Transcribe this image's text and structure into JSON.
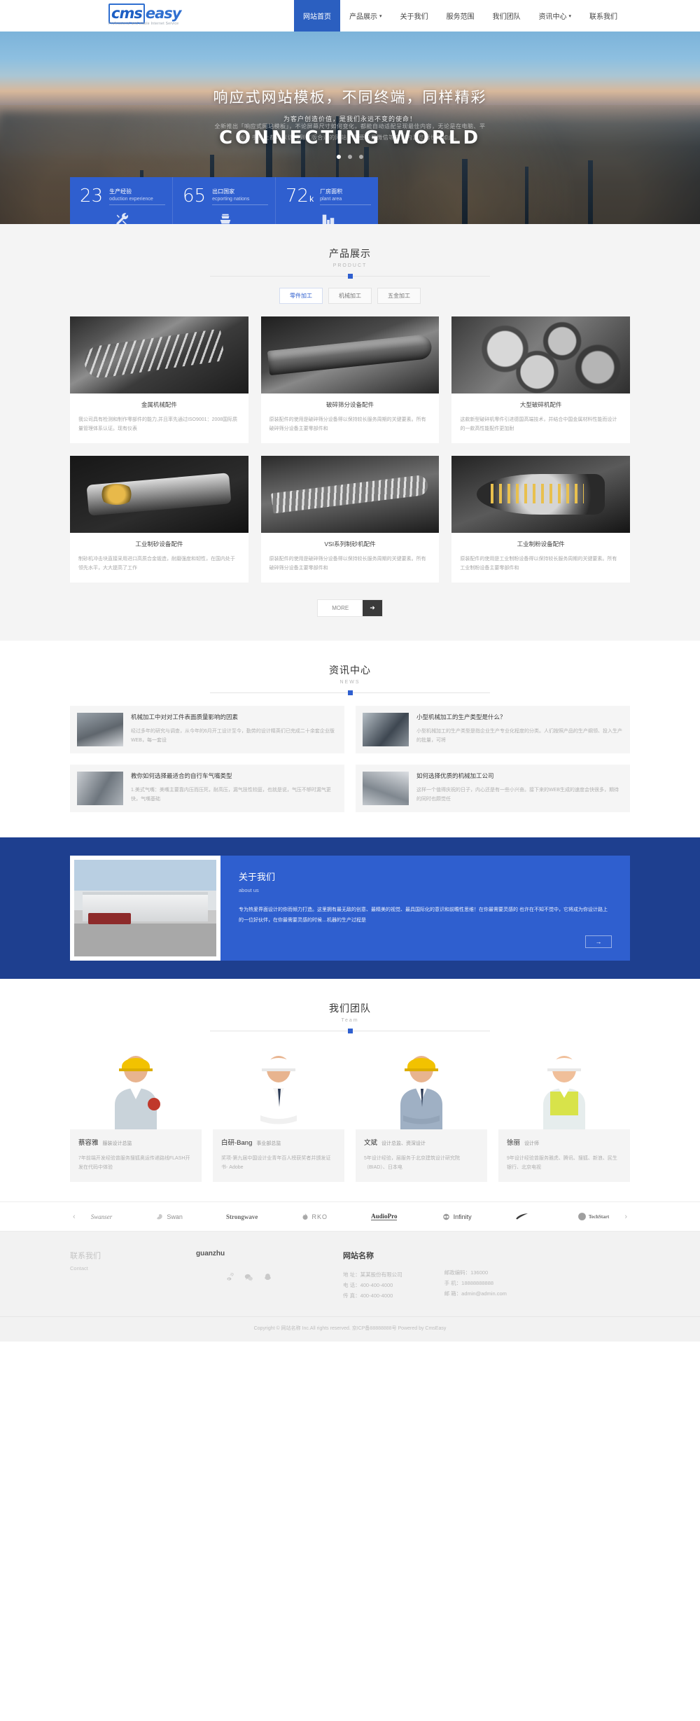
{
  "header": {
    "logo": {
      "cms": "cms",
      "easy": "easy",
      "tagline": "Professional and stable Internet Service"
    },
    "nav": [
      {
        "label": "网站首页",
        "caret": "",
        "active": true
      },
      {
        "label": "产品展示",
        "caret": "▾",
        "active": false
      },
      {
        "label": "关于我们",
        "caret": "",
        "active": false
      },
      {
        "label": "服务范围",
        "caret": "",
        "active": false
      },
      {
        "label": "我们团队",
        "caret": "",
        "active": false
      },
      {
        "label": "资讯中心",
        "caret": "▾",
        "active": false
      },
      {
        "label": "联系我们",
        "caret": "",
        "active": false
      }
    ]
  },
  "hero": {
    "headline": "响应式网站模板，不同终端，同样精彩",
    "subline": "为客户创造价值，是我们永远不变的使命！",
    "bigtext": "CONNECTING WORLD",
    "ghost_line1": "全新推出「响应式网站模板」，不论屏幕尺寸如何变化，都能自动适配呈现最佳内容，无论是在电脑、平",
    "ghost_line2": "板、手机上都可以访问到这版合适的网站，重要的是微信等应用内浏览器也是如此。"
  },
  "stats": [
    {
      "number": "23",
      "unit": "",
      "cn": "生产经验",
      "en": "oduction experience",
      "icon": "wrench-icon"
    },
    {
      "number": "65",
      "unit": "",
      "cn": "出口国家",
      "en": "ecporting nations",
      "icon": "ship-icon"
    },
    {
      "number": "72",
      "unit": "k",
      "cn": "厂房面积",
      "en": "plant area",
      "icon": "factory-icon"
    }
  ],
  "products": {
    "title_cn": "产品展示",
    "title_en": "PRODUCT",
    "tabs": [
      {
        "label": "零件加工",
        "active": true
      },
      {
        "label": "机械加工",
        "active": false
      },
      {
        "label": "五金加工",
        "active": false
      }
    ],
    "items": [
      {
        "title": "金属机械配件",
        "desc": "我公司具有检测和制作零部件的能力,并且率先通过ISO9001：2008国际质量管理体系认证。现有仪表",
        "thumb": "tool-a"
      },
      {
        "title": "破碎筛分设备配件",
        "desc": "原装配件的使用是破碎筛分设备得以保持较长服务周期的关键要素。所有破碎筛分设备主要零部件和",
        "thumb": "tool-b"
      },
      {
        "title": "大型破碎机配件",
        "desc": "这款新型破碎机零件引进德国高端技术，并结合中国金属材料性能而设计的一款高性能配件更加耐",
        "thumb": "gears"
      },
      {
        "title": "工业制砂设备配件",
        "desc": "制砂机冲击块直接采用进口高质合金锻造，耐磨强度和韧性，在国内处于领先水平，大大提高了工作",
        "thumb": "holder"
      },
      {
        "title": "VSI系列制砂机配件",
        "desc": "原装配件的使用是破碎筛分设备得以保持较长服务周期的关键要素。所有破碎筛分设备主要零部件和",
        "thumb": "drill"
      },
      {
        "title": "工业制粉设备配件",
        "desc": "原装配件的使用是工业制粉设备得以保持较长服务周期的关键要素。所有工业制粉设备主要零部件和",
        "thumb": "cutter"
      }
    ],
    "more_label": "MORE",
    "more_arrow": "➜"
  },
  "news": {
    "title_cn": "资讯中心",
    "title_en": "NEWS",
    "items": [
      {
        "title": "机械加工中对对工件表面质量影响的因素",
        "desc": "经过多年的研究与调查，从今年的6月开工设计至今，勤劳的设计精英们已完成二十余套企业版WEB，每一套设",
        "thumb": "nth-1"
      },
      {
        "title": "小型机械加工的生产类型是什么？",
        "desc": "小型机械加工的生产类型是指企业生产专业化程度的分类。人们按照产品的生产纲领、投入生产的批量，可将",
        "thumb": "nth-2"
      },
      {
        "title": "教你如何选择最适合的自行车气嘴类型",
        "desc": "1.美式气嘴：美嘴主要靠内压而压死，耐高压，漏气技性较庭，也就是说，气压不够时漏气更快，气嘴基础",
        "thumb": "nth-3"
      },
      {
        "title": "如何选择优质的机械加工公司",
        "desc": "这样一个值得庆祝的日子，内心还是有一些小兴奋。接下来的WEB生成的速度会快很多，期待的同时也颇觉任",
        "thumb": "nth-4"
      }
    ]
  },
  "about": {
    "title_cn": "关于我们",
    "title_en": "about us",
    "paragraph": "专为热爱界面设计的你而倾力打造。这里拥有最无敌的创意、最精美的视觉、最具国际化的意识和前瞻性思维！在你最需要灵感的 也许在不知不觉中，它将成为你设计路上的一位好伙伴，在你最需要灵感的时候…机器的生产过程是",
    "arrow": "→"
  },
  "team": {
    "title_cn": "我们团队",
    "title_en": "Team",
    "members": [
      {
        "name": "蔡容雅",
        "role": "服装设计总监",
        "desc": "7年前端开发经验曾服务搜狐奥运传递路线FLASH开发在代码中体验",
        "helmet": "#f2c200",
        "suit": "#c9d3da"
      },
      {
        "name": "白研-Bang",
        "role": "事业部总监",
        "desc": "奖项-第九届中国设计业青年百人榜获奖者并颁发证书- Adobe",
        "helmet": "#ffffff",
        "suit": "#ffffff"
      },
      {
        "name": "文斌",
        "role": "设计总监、资深设计",
        "desc": "5年设计经验，层服务于北京建筑设计研究院（BIAD）、日本电",
        "helmet": "#f2c200",
        "suit": "#2b3a55"
      },
      {
        "name": "徐丽",
        "role": "设计师",
        "desc": "9年设计经验曾服务雅虎、腾讯、搜狐、新浪、民生银行、北京电视",
        "helmet": "#ffffff",
        "suit": "#d8e34a"
      }
    ]
  },
  "partners": {
    "prev": "‹",
    "next": "›",
    "logos": [
      {
        "name": "Swanser",
        "style": "italic"
      },
      {
        "name": "Swan",
        "style": "swan"
      },
      {
        "name": "Strongwave",
        "style": "serif"
      },
      {
        "name": "RKO",
        "style": "rko"
      },
      {
        "name": "AudioPro",
        "style": "audiopro"
      },
      {
        "name": "Infinity",
        "style": "infinity"
      },
      {
        "name": "",
        "style": "nike"
      },
      {
        "name": "TechStart",
        "style": "techstart"
      }
    ]
  },
  "footer": {
    "contact_cn": "联系我们",
    "contact_en": "Contact",
    "follow_title": "guanzhu",
    "socials": [
      "weibo-icon",
      "wechat-icon",
      "qq-icon"
    ],
    "site_title": "网站名称",
    "col1": [
      "地 址：某某股份有限公司",
      "电 话：400-400-4000",
      "传 真：400-400-4000"
    ],
    "col2": [
      "邮政编码：136000",
      "手 机：18888888888",
      "邮 箱：admin@admin.com"
    ],
    "copyright": "Copyright © 网站名称 Inc.All rights reserved.   京ICP备88888888号   Powered by CmsEasy"
  }
}
